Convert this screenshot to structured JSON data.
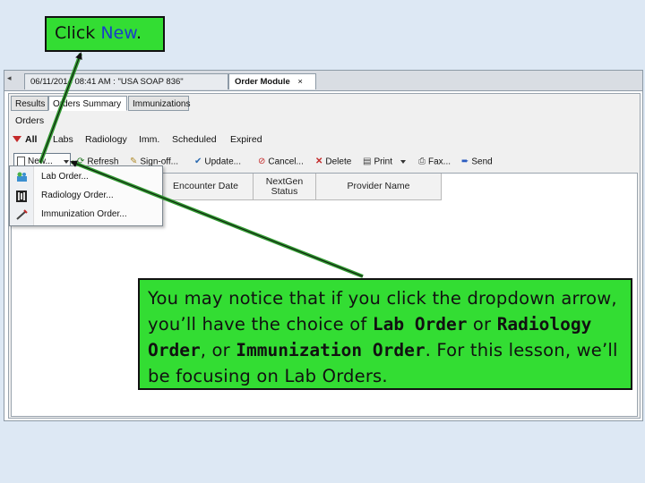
{
  "callout_top": {
    "text_before": "Click ",
    "link_text": "New",
    "text_after": "."
  },
  "app": {
    "scroll_left_glyph": "◂",
    "doc_tabs": [
      {
        "label": "06/11/2014 08:41 AM : \"USA SOAP 836\""
      },
      {
        "label": "Order Module",
        "close": "×"
      }
    ],
    "sub_tabs": [
      "Results",
      "Orders Summary",
      "Immunizations"
    ],
    "orders_label": "Orders",
    "filters": [
      "All",
      "Labs",
      "Radiology",
      "Imm.",
      "Scheduled",
      "Expired"
    ],
    "toolbar": {
      "new": "New...",
      "refresh": "Refresh",
      "signoff": "Sign-off...",
      "update": "Update...",
      "cancel": "Cancel...",
      "delete": "Delete",
      "print": "Print",
      "fax": "Fax...",
      "send": "Send"
    },
    "columns": [
      "Encounter Date",
      "NextGen Status",
      "Provider Name"
    ],
    "menu_items": [
      "Lab Order...",
      "Radiology Order...",
      "Immunization Order..."
    ]
  },
  "callout_big": {
    "t1": "You may notice that if you click the dropdown arrow, you’ll have the choice of ",
    "b1": "Lab Order",
    "t2": " or ",
    "b2": "Radiology Order",
    "t3": ", or ",
    "b3": "Immunization Order",
    "t4": ". For this lesson, we’ll be focusing on Lab Orders."
  },
  "colors": {
    "callout_green": "#33dd33",
    "link_blue": "#1a3ec8",
    "arrow_green": "#2f9a2f"
  }
}
